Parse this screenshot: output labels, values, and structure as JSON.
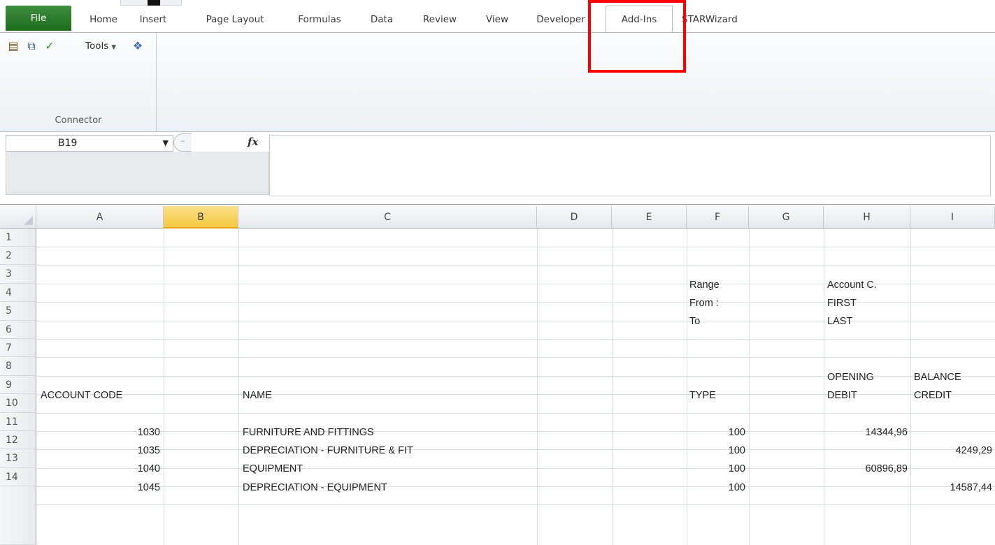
{
  "ribbon": {
    "tabs": [
      "File",
      "Home",
      "Insert",
      "Page Layout",
      "Formulas",
      "Data",
      "Review",
      "View",
      "Developer",
      "Add-Ins",
      "STARWizard"
    ],
    "active_tab": "Add-Ins",
    "tools_label": "Tools",
    "group_label": "Connector",
    "icons": [
      "connector-table-icon",
      "connector-copy-icon",
      "check-icon",
      "tools-dropdown",
      "help-icon"
    ]
  },
  "formula_bar": {
    "name_box": "B19",
    "fx_label": "fx",
    "content": ""
  },
  "grid": {
    "columns": [
      "A",
      "B",
      "C",
      "D",
      "E",
      "F",
      "G",
      "H",
      "I"
    ],
    "selected_column": "B",
    "rows": [
      "1",
      "2",
      "3",
      "4",
      "5",
      "6",
      "7",
      "8",
      "9",
      "10",
      "11",
      "12",
      "13",
      "14"
    ],
    "cells": {
      "F3": "Range",
      "H3": "Account C.",
      "F4": "From  :",
      "H4": "FIRST",
      "F5": "To",
      "H5": "LAST",
      "H8": "OPENING",
      "I8": "BALANCE",
      "A9": "ACCOUNT CODE",
      "C9": "NAME",
      "F9": "TYPE",
      "H9": "DEBIT",
      "I9": "CREDIT",
      "A11": "1030",
      "C11": "FURNITURE AND FITTINGS",
      "F11": "100",
      "H11": "14344,96",
      "A12": "1035",
      "C12": "DEPRECIATION - FURNITURE & FIT",
      "F12": "100",
      "I12": "4249,29",
      "A13": "1040",
      "C13": "EQUIPMENT",
      "F13": "100",
      "H13": "60896,89",
      "A14": "1045",
      "C14": "DEPRECIATION - EQUIPMENT",
      "F14": "100",
      "I14": "14587,44"
    }
  },
  "colors": {
    "file_tab": "#2b7a2b",
    "highlight": "#ff0000",
    "selected_header": "#f5c93f"
  }
}
